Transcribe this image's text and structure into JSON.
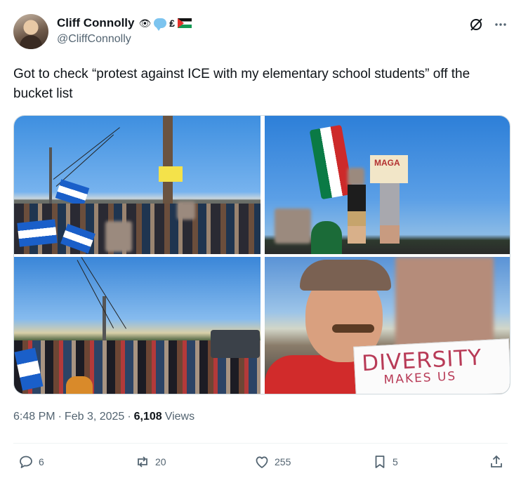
{
  "author": {
    "display_name": "Cliff Connolly",
    "handle": "@CliffConnolly",
    "badges": [
      "eye-emoji",
      "speech-bubble-emoji",
      "lira-sign-emoji",
      "palestine-flag-emoji"
    ]
  },
  "tweet": {
    "text": "Got to check “protest against ICE with my elementary school students” off the bucket list"
  },
  "media": {
    "photo_count": 4,
    "signs": {
      "photo2_sign": "MAGA",
      "photo4_sign_line1": "DIVERSITY",
      "photo4_sign_line2": "MAKES US"
    }
  },
  "meta": {
    "time": "6:48 PM",
    "date": "Feb 3, 2025",
    "views_count": "6,108",
    "views_label": "Views",
    "separator": "·"
  },
  "actions": {
    "replies": "6",
    "reposts": "20",
    "likes": "255",
    "bookmarks": "5"
  },
  "colors": {
    "text_primary": "#0f1419",
    "text_secondary": "#536471",
    "divider": "#eff3f4",
    "sign_text": "#b83b57"
  }
}
